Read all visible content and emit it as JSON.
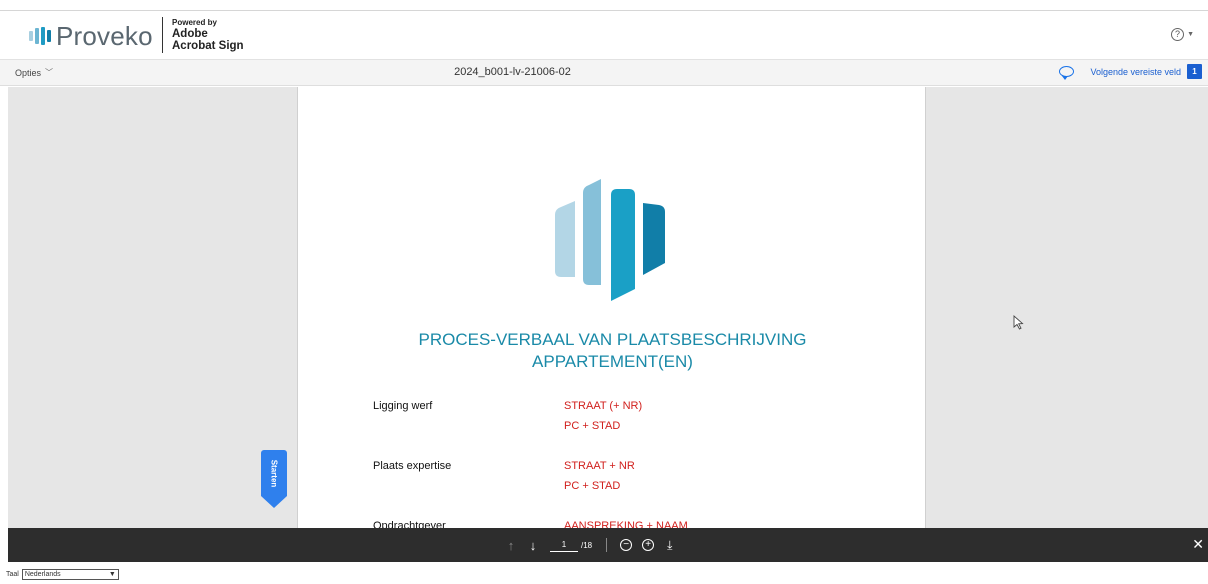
{
  "header": {
    "logo_text": "Proveko",
    "powered_line1": "Powered by",
    "powered_line2": "Adobe",
    "powered_line3": "Acrobat Sign",
    "help_symbol": "?"
  },
  "toolbar": {
    "options_label": "Opties",
    "document_title": "2024_b001-lv-21006-02",
    "next_field_label": "Volgende vereiste veld",
    "next_field_count": "1"
  },
  "document": {
    "heading_line1": "PROCES-VERBAAL VAN PLAATSBESCHRIJVING",
    "heading_line2": "APPARTEMENT(EN)",
    "rows": [
      {
        "label": "Ligging werf",
        "value1": "STRAAT (+ NR)",
        "value2": "PC + STAD"
      },
      {
        "label": "Plaats expertise",
        "value1": "STRAAT + NR",
        "value2": "PC + STAD"
      },
      {
        "label": "Opdrachtgever",
        "value1": "AANSPREKING + NAAM"
      }
    ]
  },
  "start_tab": {
    "label": "Starten"
  },
  "navigation": {
    "current_page": "1",
    "total_pages": "/18"
  },
  "language": {
    "label": "Taal",
    "selected": "Nederlands"
  },
  "colors": {
    "brand_teal": "#1a8aa8",
    "accent_blue": "#1a5fd0",
    "placeholder_red": "#d1201d"
  }
}
